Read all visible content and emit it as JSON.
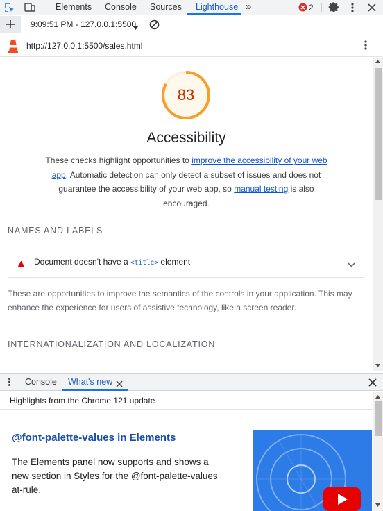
{
  "devtools": {
    "tabs": [
      {
        "label": "Elements"
      },
      {
        "label": "Console"
      },
      {
        "label": "Sources"
      },
      {
        "label": "Lighthouse"
      }
    ],
    "more_tabs": "»",
    "error_count": "2"
  },
  "toolbar": {
    "report_time": "9:09:51 PM - 127.0.0.1:5500"
  },
  "report": {
    "url": "http://127.0.0.1:5500/sales.html",
    "score": "83",
    "score_fraction": 0.83,
    "score_color": "#fa9d2a",
    "category_title": "Accessibility",
    "desc_1": "These checks highlight opportunities to ",
    "desc_link_1": "improve the accessibility of your web app",
    "desc_2": ". Automatic detection can only detect a subset of issues and does not guarantee the accessibility of your web app, so ",
    "desc_link_2": "manual testing",
    "desc_3": " is also encouraged.",
    "group_1_title": "NAMES AND LABELS",
    "audit_text_1": "Document doesn't have a ",
    "audit_code": "<title>",
    "audit_text_2": " element",
    "group_1_desc": "These are opportunities to improve the semantics of the controls in your application. This may enhance the experience for users of assistive technology, like a screen reader.",
    "group_2_title": "INTERNATIONALIZATION AND LOCALIZATION"
  },
  "drawer": {
    "tabs": [
      {
        "label": "Console"
      },
      {
        "label": "What's new"
      }
    ],
    "highlights": "Highlights from the Chrome 121 update",
    "feature_title": "@font-palette-values in Elements",
    "feature_desc": "The Elements panel now supports and shows a new section in Styles for the @font-palette-values at-rule."
  },
  "icons": {
    "inspect": "inspect-element-icon",
    "device": "device-toolbar-icon",
    "error": "error-icon",
    "settings": "gear-icon",
    "more": "kebab-menu-icon",
    "new_report": "plus-icon",
    "clear": "clear-icon",
    "lighthouse": "lighthouse-icon",
    "warning": "warning-triangle-icon",
    "expand": "chevron-down-icon",
    "close": "close-icon",
    "play": "youtube-play-icon"
  }
}
